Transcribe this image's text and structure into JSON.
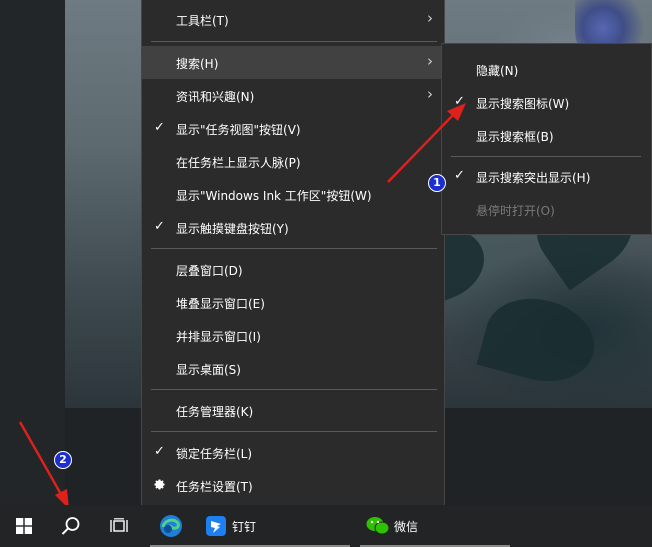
{
  "context_menu": {
    "items": [
      {
        "label": "工具栏(T)",
        "checked": false,
        "submenu": true
      },
      {
        "label": "搜索(H)",
        "checked": false,
        "submenu": true,
        "highlighted": true
      },
      {
        "label": "资讯和兴趣(N)",
        "checked": false,
        "submenu": true
      },
      {
        "label": "显示\"任务视图\"按钮(V)",
        "checked": true
      },
      {
        "label": "在任务栏上显示人脉(P)",
        "checked": false
      },
      {
        "label": "显示\"Windows Ink 工作区\"按钮(W)",
        "checked": false
      },
      {
        "label": "显示触摸键盘按钮(Y)",
        "checked": true
      },
      {
        "label": "层叠窗口(D)",
        "checked": false
      },
      {
        "label": "堆叠显示窗口(E)",
        "checked": false
      },
      {
        "label": "并排显示窗口(I)",
        "checked": false
      },
      {
        "label": "显示桌面(S)",
        "checked": false
      },
      {
        "label": "任务管理器(K)",
        "checked": false
      },
      {
        "label": "锁定任务栏(L)",
        "checked": true
      },
      {
        "label": "任务栏设置(T)",
        "checked": false,
        "icon": "gear-icon"
      }
    ]
  },
  "search_submenu": {
    "items": [
      {
        "label": "隐藏(N)",
        "checked": false
      },
      {
        "label": "显示搜索图标(W)",
        "checked": true
      },
      {
        "label": "显示搜索框(B)",
        "checked": false
      },
      {
        "label": "显示搜索突出显示(H)",
        "checked": true
      },
      {
        "label": "悬停时打开(O)",
        "checked": false,
        "disabled": true
      }
    ]
  },
  "annotations": {
    "badge1": "1",
    "badge2": "2",
    "arrow_color": "#e0201b",
    "badge_color": "#1b2fd0"
  },
  "taskbar": {
    "apps": [
      {
        "icon": "windows-start-icon"
      },
      {
        "icon": "search-icon"
      },
      {
        "icon": "task-view-icon"
      },
      {
        "icon": "edge-icon"
      },
      {
        "icon": "dingtalk-icon",
        "label": "钉钉"
      },
      {
        "icon": "wechat-icon",
        "label": "微信"
      }
    ]
  },
  "symbols": {
    "check": "✓",
    "arrow": "›"
  }
}
